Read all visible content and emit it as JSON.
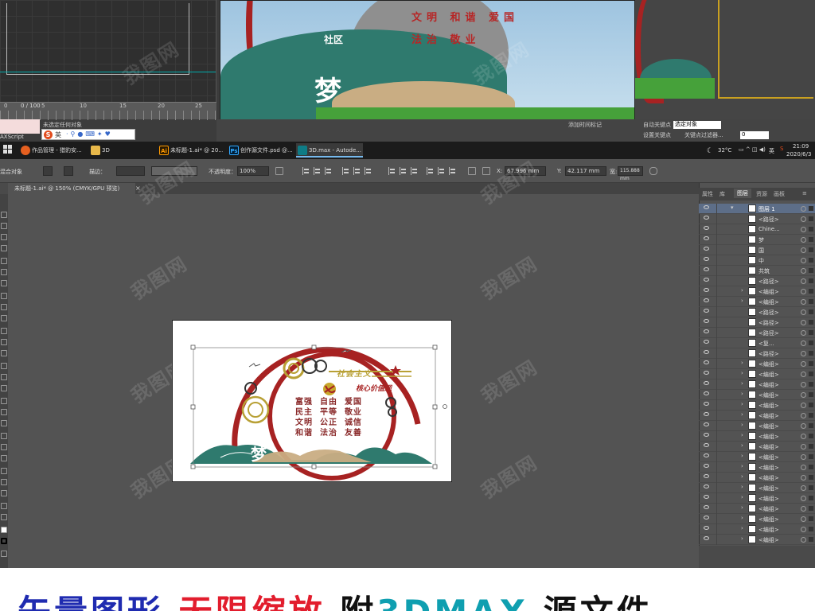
{
  "max": {
    "frame_counter": "0 / 100",
    "timeline_ticks": [
      "0",
      "5",
      "10",
      "15",
      "20",
      "25"
    ],
    "maxscript_label": "AXScript",
    "status_text": "未选定任何对象",
    "controls": {
      "auto_key_label": "自动关键点",
      "auto_key_value": "选定对象",
      "set_key_label": "设置关键点",
      "key_filter_label": "关键点过滤器...",
      "add_time_tag": "添加时间标记",
      "frame_value": "0"
    },
    "ime_label": "英",
    "render_text": {
      "line1": "文明 和谐 爱国",
      "line2": "法治 敬业",
      "glyph_small": "社区",
      "glyph_big": "梦"
    }
  },
  "taskbar": {
    "items": [
      {
        "icon": "browser-icon",
        "label": "作品管理 - 猎豹安..."
      },
      {
        "icon": "folder-icon",
        "label": "3D"
      },
      {
        "icon": "illustrator-icon",
        "label": "未标题-1.ai* @ 20..."
      },
      {
        "icon": "photoshop-icon",
        "label": "创作源文件.psd @..."
      },
      {
        "icon": "3dsmax-icon",
        "label": "3D.max - Autode..."
      }
    ],
    "weather": "32°C",
    "lang": "英",
    "time": "21:09",
    "date": "2020/6/3"
  },
  "control_bar": {
    "mode": "混合对象",
    "stroke_label": "描边：",
    "opacity_label": "不透明度：",
    "opacity_value": "100%",
    "x_label": "X:",
    "x_value": "67.996 mm",
    "y_label": "Y:",
    "y_value": "42.117 mm",
    "w_label": "宽:",
    "w_value": "115.888 mm"
  },
  "document": {
    "tab_title": "未标题-1.ai* @ 150% (CMYK/GPU 预览)",
    "close": "×"
  },
  "artwork": {
    "banner_text": "社会主义",
    "banner_text2": "核心价值观",
    "values": [
      [
        "富强",
        "自由",
        "爱国"
      ],
      [
        "民主",
        "平等",
        "敬业"
      ],
      [
        "文明",
        "公正",
        "诚信"
      ],
      [
        "和谐",
        "法治",
        "友善"
      ]
    ],
    "dream_small": "中国",
    "dream_big": "梦"
  },
  "panel": {
    "tabs": [
      "属性",
      "库",
      "图层",
      "资源",
      "画板"
    ],
    "active_tab": "图层",
    "layers": [
      {
        "name": "图层 1",
        "top": true,
        "expand": "▾"
      },
      {
        "name": "<路径>",
        "expand": ""
      },
      {
        "name": "Chine...",
        "expand": ""
      },
      {
        "name": "梦",
        "expand": ""
      },
      {
        "name": "国",
        "expand": ""
      },
      {
        "name": "中",
        "expand": ""
      },
      {
        "name": "共筑",
        "expand": ""
      },
      {
        "name": "<路径>",
        "expand": ""
      },
      {
        "name": "<编组>",
        "expand": "›"
      },
      {
        "name": "<编组>",
        "expand": "›"
      },
      {
        "name": "<路径>",
        "expand": ""
      },
      {
        "name": "<路径>",
        "expand": ""
      },
      {
        "name": "<路径>",
        "expand": ""
      },
      {
        "name": "<复...",
        "expand": ""
      },
      {
        "name": "<路径>",
        "expand": ""
      },
      {
        "name": "<编组>",
        "expand": "›"
      },
      {
        "name": "<编组>",
        "expand": "›"
      },
      {
        "name": "<编组>",
        "expand": "›"
      },
      {
        "name": "<编组>",
        "expand": "›"
      },
      {
        "name": "<编组>",
        "expand": "›"
      },
      {
        "name": "<编组>",
        "expand": "›"
      },
      {
        "name": "<编组>",
        "expand": "›"
      },
      {
        "name": "<编组>",
        "expand": "›"
      },
      {
        "name": "<编组>",
        "expand": "›"
      },
      {
        "name": "<编组>",
        "expand": "›"
      },
      {
        "name": "<编组>",
        "expand": "›"
      },
      {
        "name": "<编组>",
        "expand": "›"
      },
      {
        "name": "<编组>",
        "expand": "›"
      },
      {
        "name": "<编组>",
        "expand": "›"
      },
      {
        "name": "<编组>",
        "expand": "›"
      },
      {
        "name": "<编组>",
        "expand": "›"
      },
      {
        "name": "<编组>",
        "expand": "›"
      },
      {
        "name": "<编组>",
        "expand": "›"
      }
    ]
  },
  "banner": {
    "part1": "矢量图形",
    "part2": "无限缩放",
    "part3": "附",
    "part4": "3DMAX",
    "part5": "源文件"
  },
  "watermark": "我图网",
  "colors": {
    "red": "#a72222",
    "teal": "#2f7a6e",
    "sand": "#c9ad83",
    "gold": "#b8a035"
  }
}
